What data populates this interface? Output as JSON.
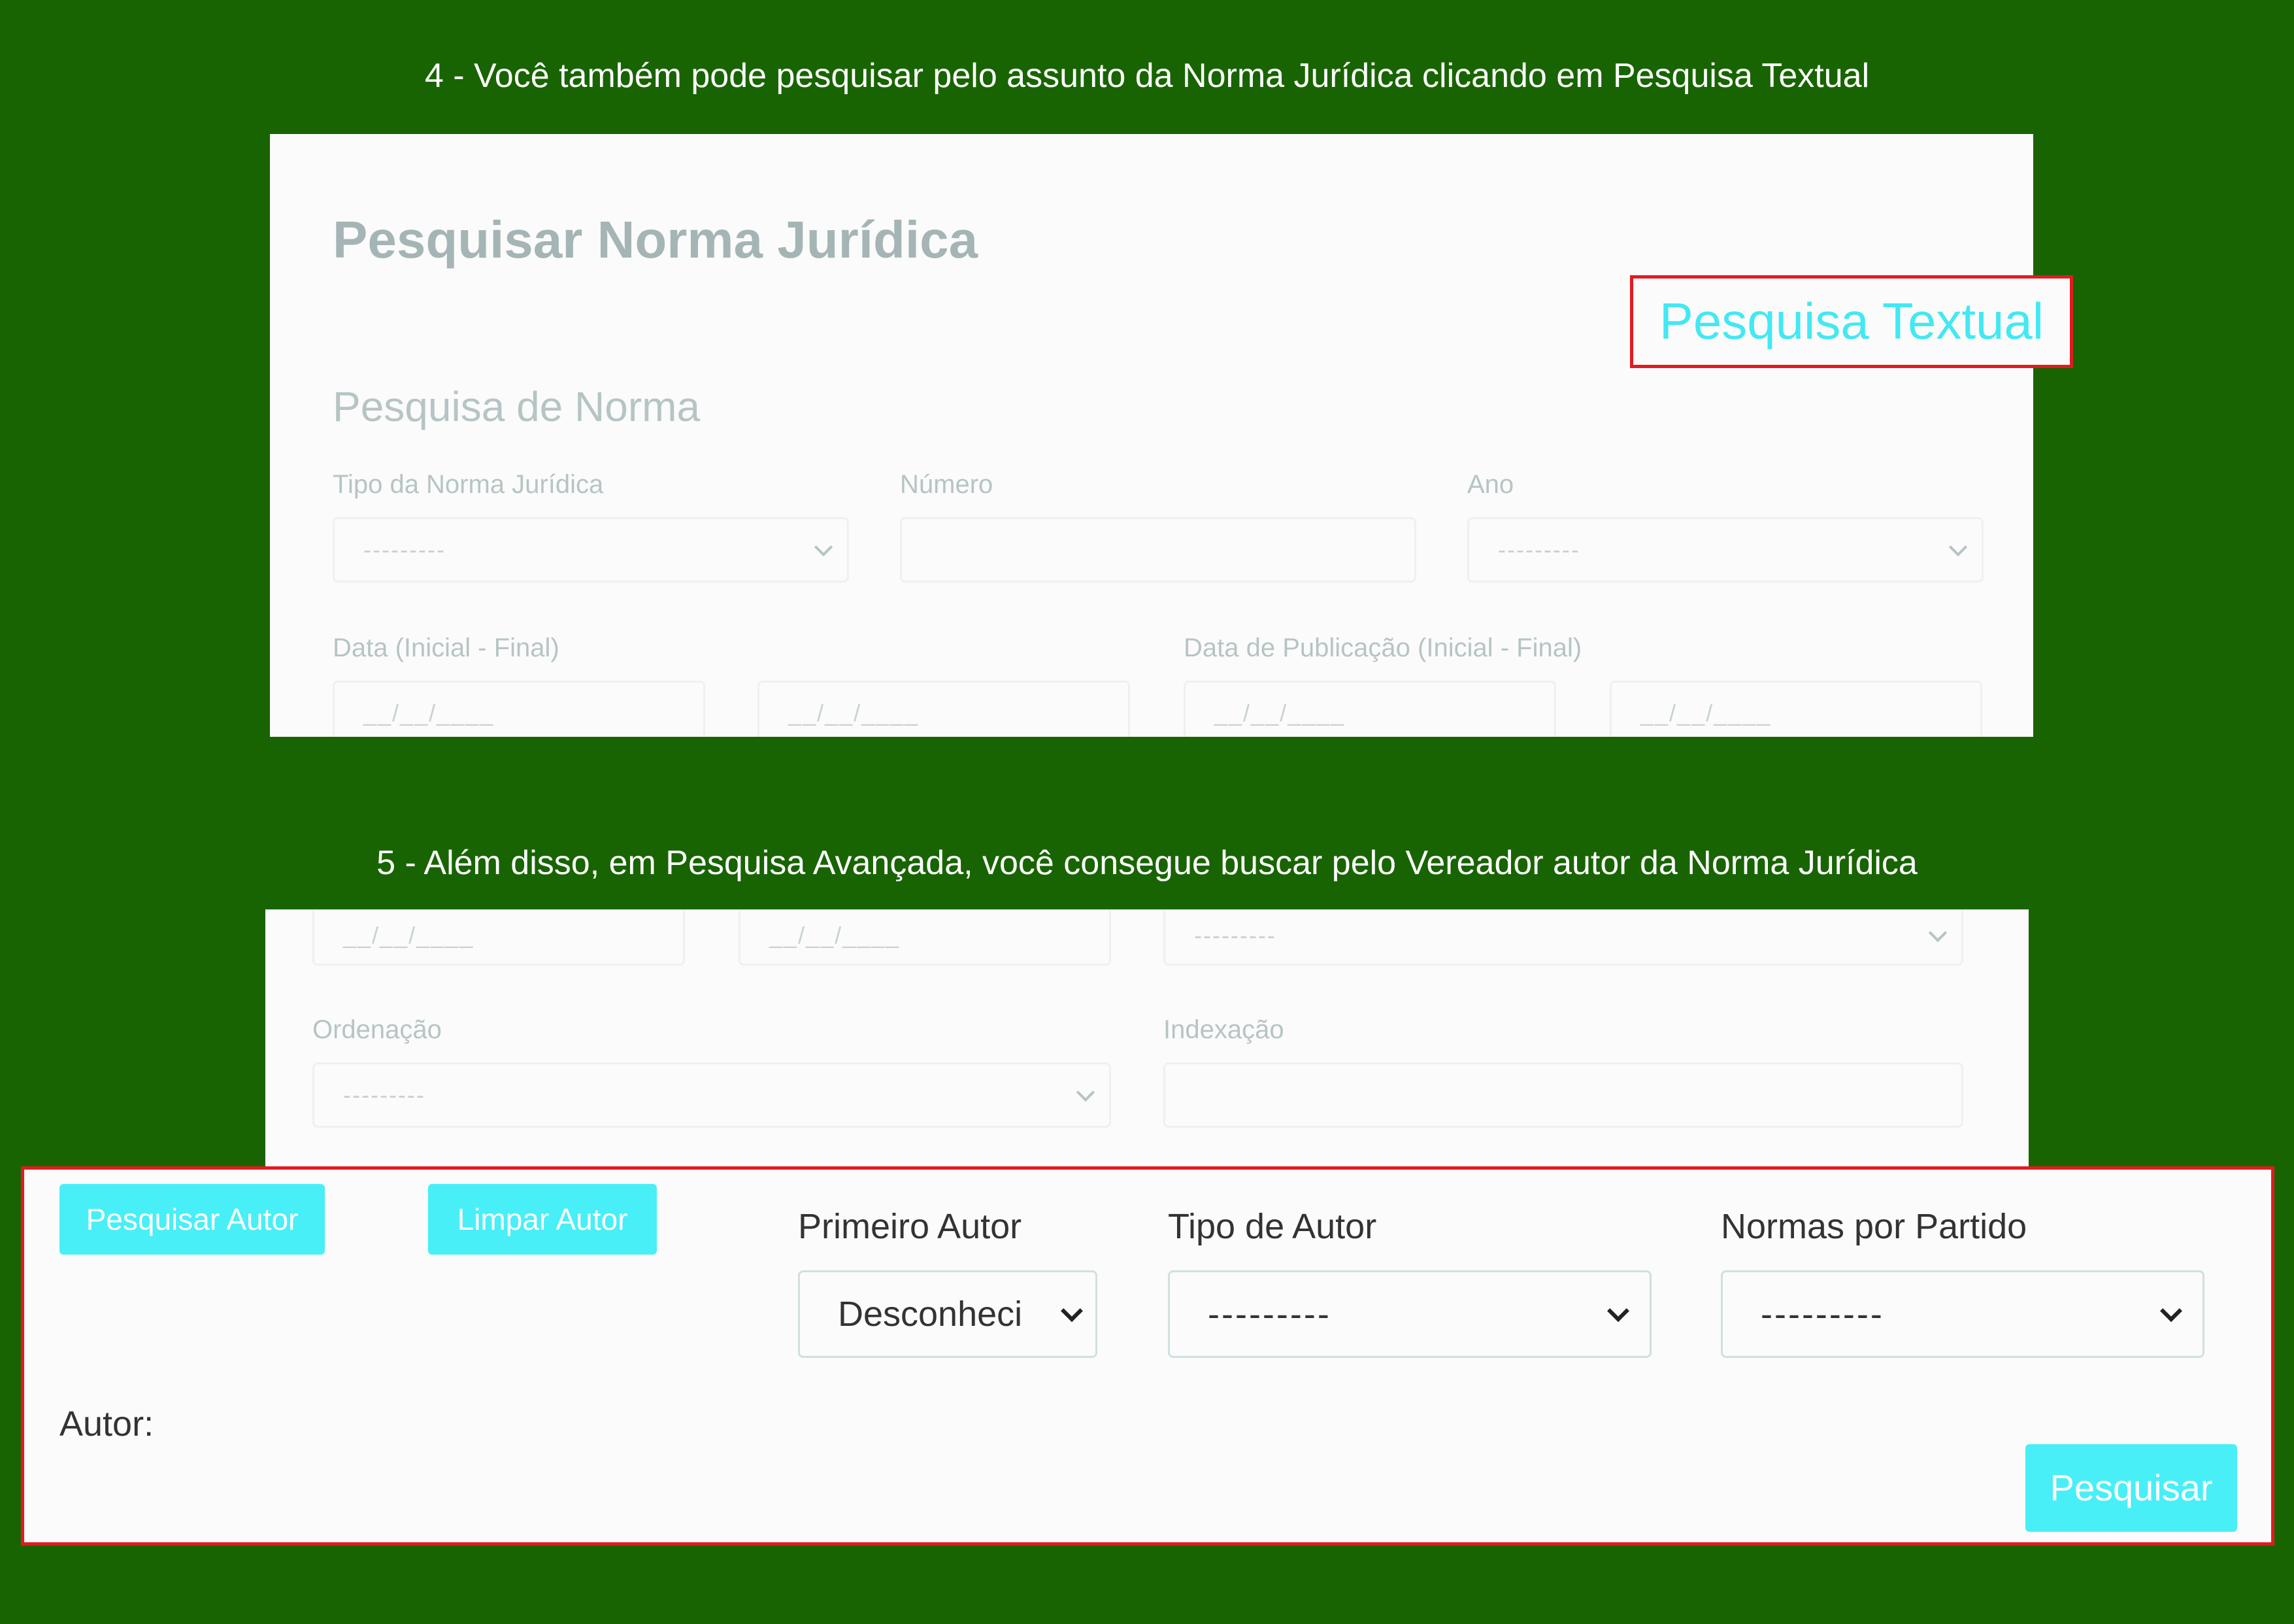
{
  "captions": {
    "step4": "4 - Você também pode pesquisar pelo assunto da Norma Jurídica clicando em Pesquisa Textual",
    "step5": "5 - Além disso, em Pesquisa Avançada, você consegue buscar pelo Vereador autor da Norma Jurídica"
  },
  "top_panel": {
    "title": "Pesquisar Norma Jurídica",
    "textual_search_link": "Pesquisa Textual",
    "section_title": "Pesquisa de Norma",
    "fields": {
      "tipo_label": "Tipo da Norma Jurídica",
      "tipo_value": "---------",
      "numero_label": "Número",
      "numero_value": "",
      "ano_label": "Ano",
      "ano_value": "---------",
      "data_label": "Data (Inicial - Final)",
      "data_inicial": "__/__/____",
      "data_final": "__/__/____",
      "publicacao_label": "Data de Publicação (Inicial - Final)",
      "publicacao_inicial": "__/__/____",
      "publicacao_final": "__/__/____"
    }
  },
  "middle_panel": {
    "date_a": "__/__/____",
    "date_b": "__/__/____",
    "select_top_value": "---------",
    "ordenacao_label": "Ordenação",
    "ordenacao_value": "---------",
    "indexacao_label": "Indexação",
    "indexacao_value": ""
  },
  "author_panel": {
    "search_author_button": "Pesquisar Autor",
    "clear_author_button": "Limpar Autor",
    "primeiro_autor_label": "Primeiro Autor",
    "primeiro_autor_value": "Desconheci",
    "tipo_autor_label": "Tipo de Autor",
    "tipo_autor_value": "---------",
    "normas_partido_label": "Normas por Partido",
    "normas_partido_value": "---------",
    "autor_label": "Autor:",
    "submit_button": "Pesquisar"
  },
  "colors": {
    "background": "#196402",
    "highlight_border": "#e11b20",
    "accent_cyan": "#48eff6",
    "link_cyan": "#43e8f2"
  }
}
